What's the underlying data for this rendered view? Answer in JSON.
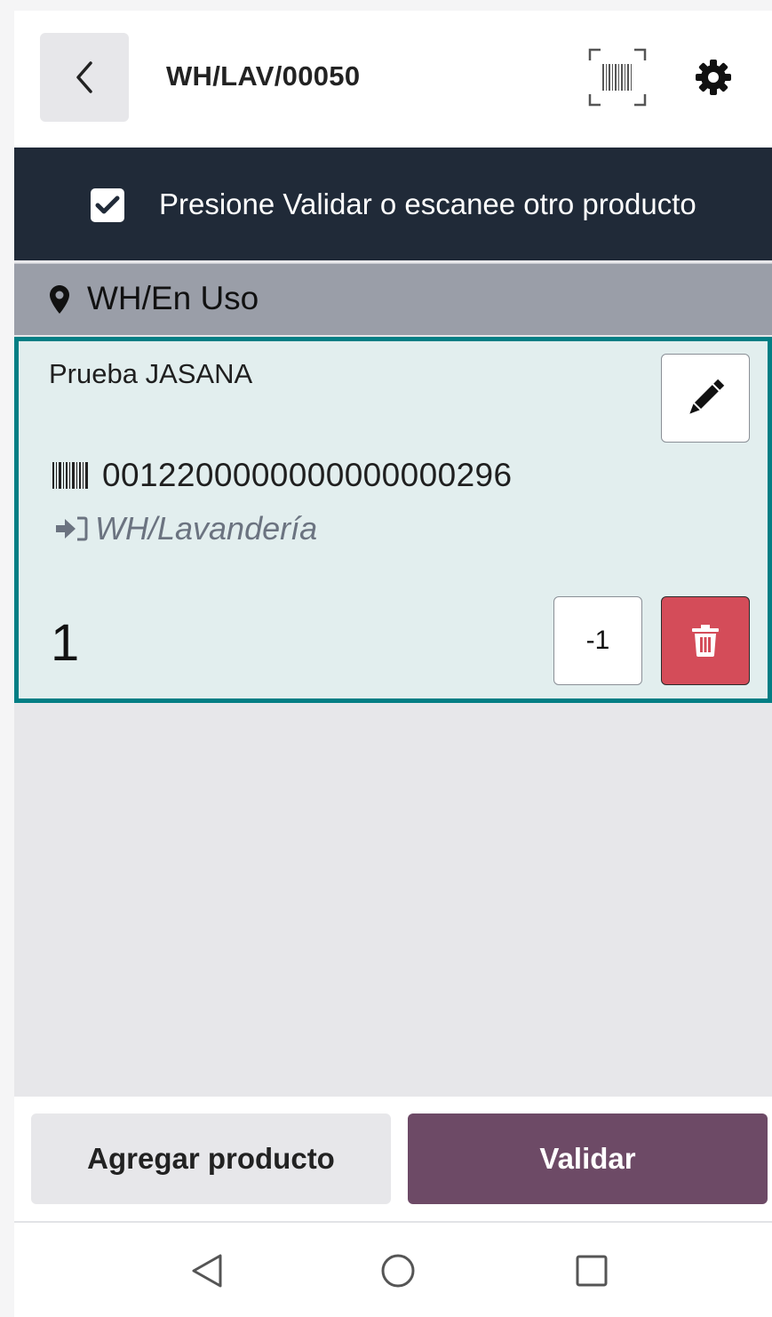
{
  "header": {
    "title": "WH/LAV/00050",
    "back_icon": "chevron-left-icon",
    "scan_icon": "barcode-scan-icon",
    "settings_icon": "gear-icon"
  },
  "banner": {
    "message": "Presione Validar o escanee otro producto",
    "icon": "check-square-icon"
  },
  "location": {
    "name": "WH/En Uso",
    "icon": "map-marker-icon"
  },
  "line": {
    "product": "Prueba JASANA",
    "barcode": "0012200000000000000296",
    "destination": "WH/Lavandería",
    "quantity": "1",
    "decrement_label": "-1",
    "edit_icon": "pencil-icon",
    "delete_icon": "trash-icon"
  },
  "footer": {
    "add_product_label": "Agregar producto",
    "validate_label": "Validar"
  },
  "colors": {
    "banner_bg": "#202a38",
    "location_bg": "#9a9ea8",
    "card_border": "#017e84",
    "card_bg": "#e2eeee",
    "delete_bg": "#d44c59",
    "validate_bg": "#6d4a66"
  }
}
